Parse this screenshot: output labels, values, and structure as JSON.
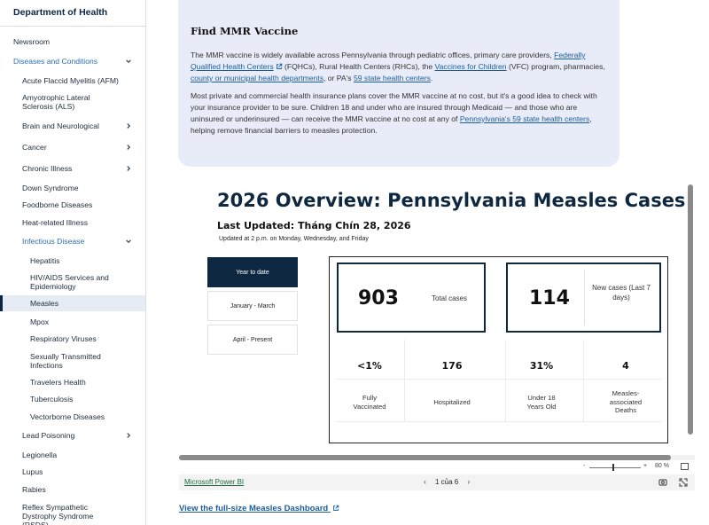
{
  "sidebar": {
    "header": "Department of Health",
    "items": [
      {
        "label": "Newsroom"
      },
      {
        "label": "Diseases and Conditions"
      },
      {
        "label": "Acute Flaccid Myelitis (AFM)"
      },
      {
        "label": "Amyotrophic Lateral Sclerosis (ALS)"
      },
      {
        "label": "Brain and Neurological"
      },
      {
        "label": "Cancer"
      },
      {
        "label": "Chronic Illness"
      },
      {
        "label": "Down Syndrome"
      },
      {
        "label": "Foodborne Diseases"
      },
      {
        "label": "Heat-related Illness"
      },
      {
        "label": "Infectious Disease"
      },
      {
        "label": "Hepatitis"
      },
      {
        "label": "HIV/AIDS Services and Epidemiology"
      },
      {
        "label": "Measles"
      },
      {
        "label": "Mpox"
      },
      {
        "label": "Respiratory Viruses"
      },
      {
        "label": "Sexually Transmitted Infections"
      },
      {
        "label": "Travelers Health"
      },
      {
        "label": "Tuberculosis"
      },
      {
        "label": "Vectorborne Diseases"
      },
      {
        "label": "Lead Poisoning"
      },
      {
        "label": "Legionella"
      },
      {
        "label": "Lupus"
      },
      {
        "label": "Rabies"
      },
      {
        "label": "Reflex Sympathetic Dystrophy Syndrome (RSDS)"
      }
    ]
  },
  "info": {
    "title": "Find MMR Vaccine",
    "p1_a": "The MMR vaccine is widely available across Pennsylvania through pediatric offices, primary care providers,",
    "p1_link1": "Federally Qualified Health Centers",
    "p1_b": "(FQHCs), Rural Health Centers (RHCs), the",
    "p1_link2": "Vaccines for Children",
    "p1_c": "(VFC) program, pharmacies,",
    "p1_link3": "county or municipal health departments",
    "p1_d": ", or PA's",
    "p1_link4": "59 state health centers",
    "p1_e": ".",
    "p2_a": "Most private and commercial health insurance plans cover the MMR vaccine at no cost, but it's a good idea to check with your insurance provider to be sure. Children 18 and under who are insured through Medicaid — and those who are uninsured or underinsured — can receive the MMR vaccine at no cost at any of",
    "p2_link": "Pennsylvania's 59 state health centers",
    "p2_b": ", helping remove financial barriers to measles protection."
  },
  "report": {
    "title": "2026 Overview: Pennsylvania Measles Cases",
    "updated": "Last Updated: Tháng Chín 28, 2026",
    "schedule": "Updated at 2 p.m. on Monday, Wednesday, and Friday",
    "tabs": [
      "Year to date",
      "January - March",
      "April - Present"
    ],
    "total_cases": {
      "value": "903",
      "label": "Total cases"
    },
    "new_cases": {
      "value": "114",
      "label": "New cases (Last 7 days)"
    },
    "stats": [
      {
        "value": "<1%",
        "label": "Fully Vaccinated"
      },
      {
        "value": "176",
        "label": "Hospitalized"
      },
      {
        "value": "31%",
        "label": "Under 18 Years Old"
      },
      {
        "value": "4",
        "label": "Measles-associated Deaths"
      }
    ],
    "zoom_minus": "-",
    "zoom_plus": "+",
    "zoom_level": "80 %",
    "zoom_fraction": 0.45
  },
  "footer": {
    "powerbi_link": "Microsoft Power BI",
    "page_indicator": "1 của 6",
    "prev": "‹",
    "next": "›"
  },
  "dashboard_link": "View the full-size Measles Dashboard",
  "colors": {
    "navy": "#0e2841",
    "link": "#1c5d99",
    "card": "#e8ecf8"
  }
}
